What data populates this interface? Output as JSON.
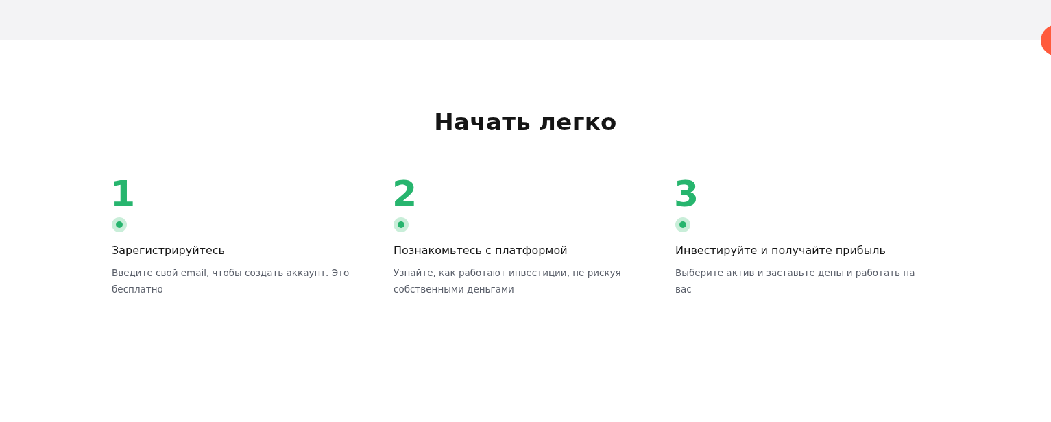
{
  "section": {
    "title": "Начать легко"
  },
  "steps": [
    {
      "number": "1",
      "title": "Зарегистрируйтесь",
      "description": "Введите свой email, чтобы создать аккаунт. Это бесплатно"
    },
    {
      "number": "2",
      "title": "Познакомьтесь с платформой",
      "description": "Узнайте, как работают инвестиции, не рискуя собственными деньгами"
    },
    {
      "number": "3",
      "title": "Инвестируйте и получайте прибыль",
      "description": "Выберите актив и заставьте деньги работать на вас"
    }
  ]
}
